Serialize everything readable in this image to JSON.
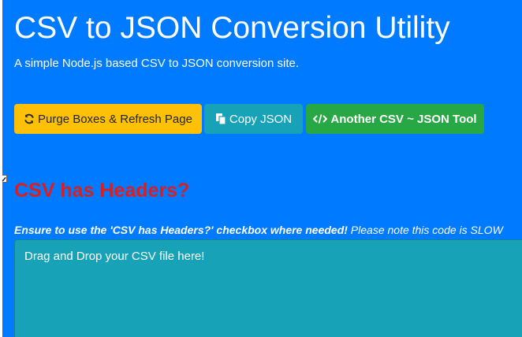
{
  "header": {
    "title": "CSV to JSON Conversion Utility",
    "subtitle": "A simple Node.js based CSV to JSON conversion site."
  },
  "toolbar": {
    "purge_label": "Purge Boxes & Refresh Page",
    "copy_label": "Copy JSON",
    "tool_label": "Another CSV ~ JSON Tool",
    "purge_icon": "refresh-icon",
    "copy_icon": "copy-icon",
    "tool_icon": "code-icon"
  },
  "options": {
    "headers_checkbox_checked": true,
    "headers_label": "CSV has Headers?"
  },
  "note": {
    "bold_text": "Ensure to use the 'CSV has Headers?' checkbox where needed!",
    "normal_text": "Please note this code is SLOW"
  },
  "dropzone": {
    "text": "Drag and Drop your CSV file here!"
  },
  "colors": {
    "background": "#007bff",
    "warning": "#ffc107",
    "info": "#17a2b8",
    "success": "#28a745",
    "danger_text": "#dc1e1e"
  }
}
